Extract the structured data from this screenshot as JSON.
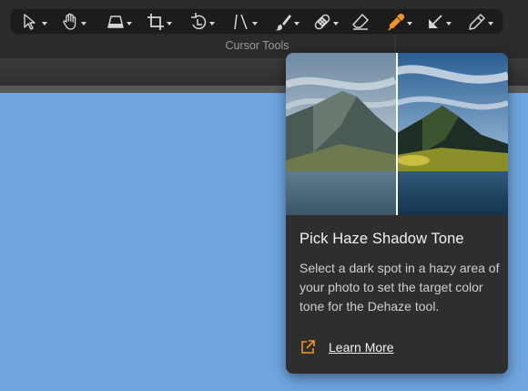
{
  "toolbar": {
    "caption": "Cursor Tools",
    "tools": [
      {
        "name": "select-tool",
        "icon": "arrow-pointer-icon"
      },
      {
        "name": "pan-tool",
        "icon": "hand-icon"
      },
      {
        "name": "perspective-tool",
        "icon": "trapezoid-icon"
      },
      {
        "name": "crop-tool",
        "icon": "crop-icon"
      },
      {
        "name": "rotate-tool",
        "icon": "rotate-icon"
      },
      {
        "name": "straighten-tool",
        "icon": "straighten-icon"
      },
      {
        "name": "brush-tool",
        "icon": "brush-icon"
      },
      {
        "name": "healing-tool",
        "icon": "bandage-icon"
      },
      {
        "name": "eraser-tool",
        "icon": "eraser-icon"
      },
      {
        "name": "pick-haze-tool",
        "icon": "eyedropper-icon",
        "active": true
      },
      {
        "name": "gradient-tool",
        "icon": "gradient-arrow-icon"
      },
      {
        "name": "annotate-tool",
        "icon": "pencil-icon"
      }
    ],
    "accent_color": "#f0932b"
  },
  "popover": {
    "title": "Pick Haze Shadow Tone",
    "description": "Select a dark spot in a hazy area of your photo to set the target color tone for the Dehaze tool.",
    "link_label": "Learn More",
    "link_icon": "external-link-icon"
  },
  "colors": {
    "canvas": "#6fa5e0",
    "popover_bg": "#2e2e2e",
    "toolbar_bg": "#1c1c1c"
  }
}
